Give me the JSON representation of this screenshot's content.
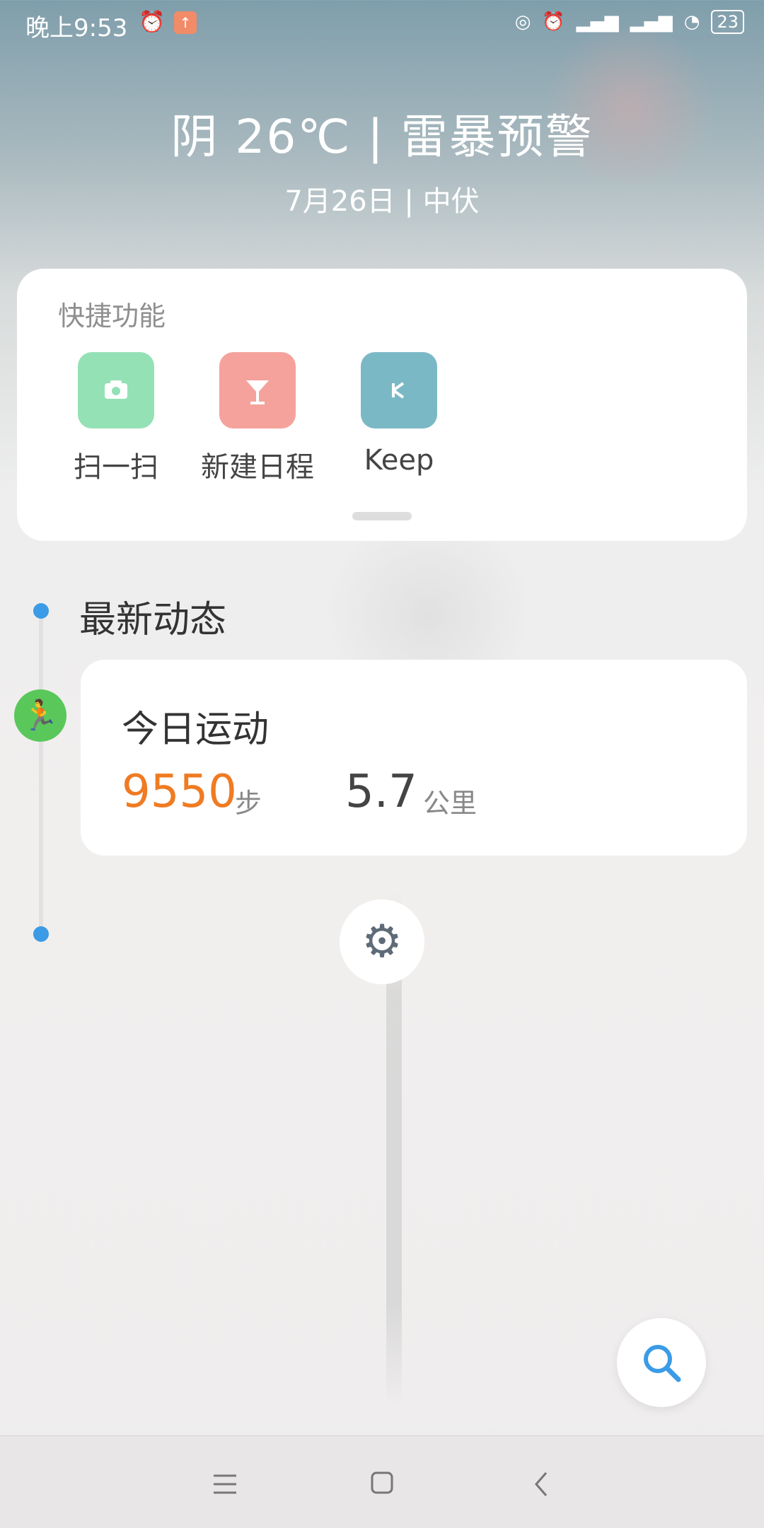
{
  "status_bar": {
    "time": "晚上9:53",
    "alarm_icon": "alarm-icon",
    "notification_icon": "app-notification-icon",
    "indicators": [
      "hotspot-icon",
      "alarm-icon",
      "signal-icon",
      "signal-hd-icon",
      "wifi-icon"
    ],
    "battery": "23"
  },
  "weather": {
    "main": "阴  26℃  |  雷暴预警",
    "date": "7月26日 | 中伏"
  },
  "quick_actions": {
    "title": "快捷功能",
    "items": [
      {
        "label": "扫一扫",
        "icon": "camera-icon",
        "color": "#94e1b6"
      },
      {
        "label": "新建日程",
        "icon": "cocktail-icon",
        "color": "#f5a29c"
      },
      {
        "label": "Keep",
        "icon": "keep-icon",
        "color": "#7bb8c5"
      }
    ]
  },
  "feed": {
    "title": "最新动态",
    "sport_card": {
      "title": "今日运动",
      "steps": "9550",
      "steps_unit": "步",
      "distance": "5.7",
      "distance_unit": "公里"
    }
  },
  "colors": {
    "accent_blue": "#3b9be6",
    "steps_orange": "#ef7b22",
    "run_green": "#5ac75b"
  }
}
